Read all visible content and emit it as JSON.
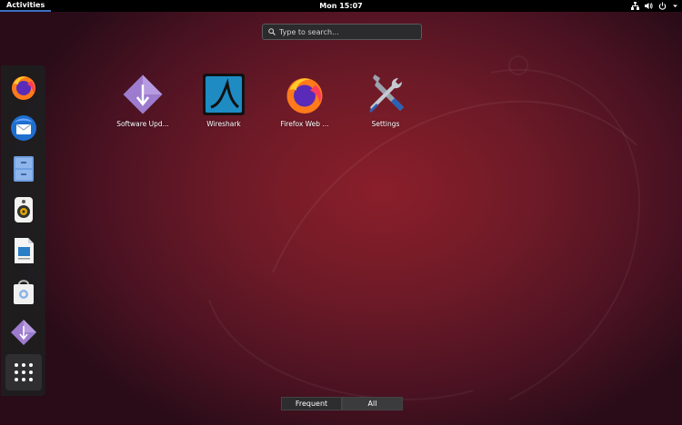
{
  "topbar": {
    "activities_label": "Activities",
    "clock": "Mon 15:07",
    "status_icons": [
      "network-icon",
      "volume-icon",
      "power-icon",
      "menu-arrow-icon"
    ]
  },
  "search": {
    "placeholder": "Type to search..."
  },
  "dock": {
    "items": [
      {
        "icon": "firefox-icon"
      },
      {
        "icon": "thunderbird-icon"
      },
      {
        "icon": "files-icon"
      },
      {
        "icon": "rhythmbox-icon"
      },
      {
        "icon": "writer-icon"
      },
      {
        "icon": "software-icon"
      },
      {
        "icon": "software-updater-icon"
      },
      {
        "icon": "show-applications-icon"
      }
    ]
  },
  "apps": [
    {
      "label": "Software Upd...",
      "icon": "software-updater-icon"
    },
    {
      "label": "Wireshark",
      "icon": "wireshark-icon"
    },
    {
      "label": "Firefox Web ...",
      "icon": "firefox-icon"
    },
    {
      "label": "Settings",
      "icon": "settings-icon"
    }
  ],
  "switcher": {
    "frequent": "Frequent",
    "all": "All",
    "selected": "All"
  },
  "colors": {
    "accent": "#3a6fc4",
    "bg_center": "#8a1f2a",
    "bg_edge": "#2a0c18"
  }
}
